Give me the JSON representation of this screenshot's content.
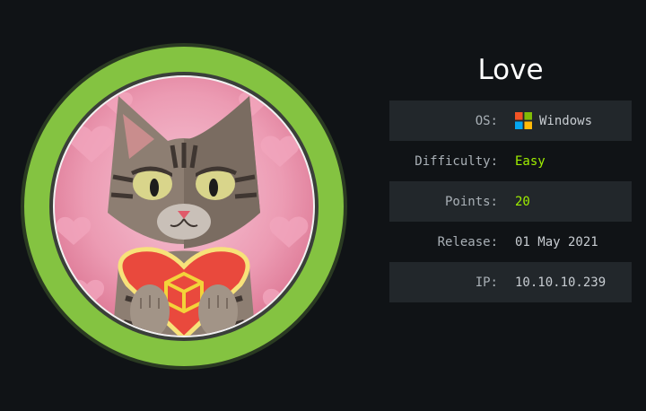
{
  "machine": {
    "name": "Love",
    "difficulty_color": "#9fef00",
    "ring_color": "#84c341"
  },
  "info": {
    "os_label": "OS:",
    "os_value": "Windows",
    "os_icon": "windows-icon",
    "difficulty_label": "Difficulty:",
    "difficulty_value": "Easy",
    "points_label": "Points:",
    "points_value": "20",
    "release_label": "Release:",
    "release_value": "01 May 2021",
    "ip_label": "IP:",
    "ip_value": "10.10.10.239"
  },
  "avatar": {
    "icon": "cat-holding-heart-icon"
  }
}
